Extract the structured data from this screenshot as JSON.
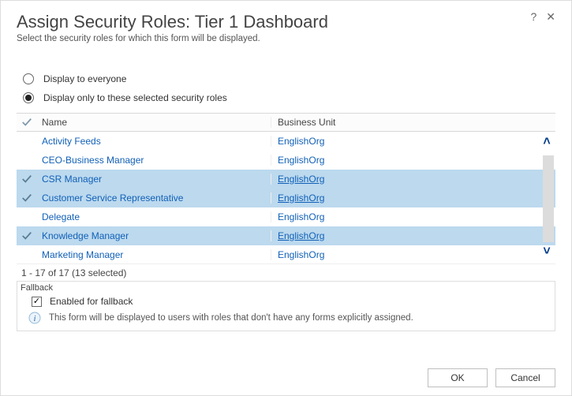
{
  "header": {
    "title": "Assign Security Roles: Tier 1 Dashboard",
    "subtitle": "Select the security roles for which this form will be displayed."
  },
  "radios": {
    "everyone": "Display to everyone",
    "selected": "Display only to these selected security roles",
    "value": "selected"
  },
  "columns": {
    "name": "Name",
    "bu": "Business Unit"
  },
  "rows": [
    {
      "name": "Activity Feeds",
      "bu": "EnglishOrg",
      "checked": false
    },
    {
      "name": "CEO-Business Manager",
      "bu": "EnglishOrg",
      "checked": false
    },
    {
      "name": "CSR Manager",
      "bu": "EnglishOrg",
      "checked": true
    },
    {
      "name": "Customer Service Representative",
      "bu": "EnglishOrg",
      "checked": true
    },
    {
      "name": "Delegate",
      "bu": "EnglishOrg",
      "checked": false
    },
    {
      "name": "Knowledge Manager",
      "bu": "EnglishOrg",
      "checked": true
    },
    {
      "name": "Marketing Manager",
      "bu": "EnglishOrg",
      "checked": false
    }
  ],
  "page_count": "1 - 17 of 17 (13 selected)",
  "fallback": {
    "section": "Fallback",
    "enabled_label": "Enabled for fallback",
    "enabled": true,
    "info": "This form will be displayed to users with roles that don't have any forms explicitly assigned."
  },
  "buttons": {
    "ok": "OK",
    "cancel": "Cancel"
  }
}
